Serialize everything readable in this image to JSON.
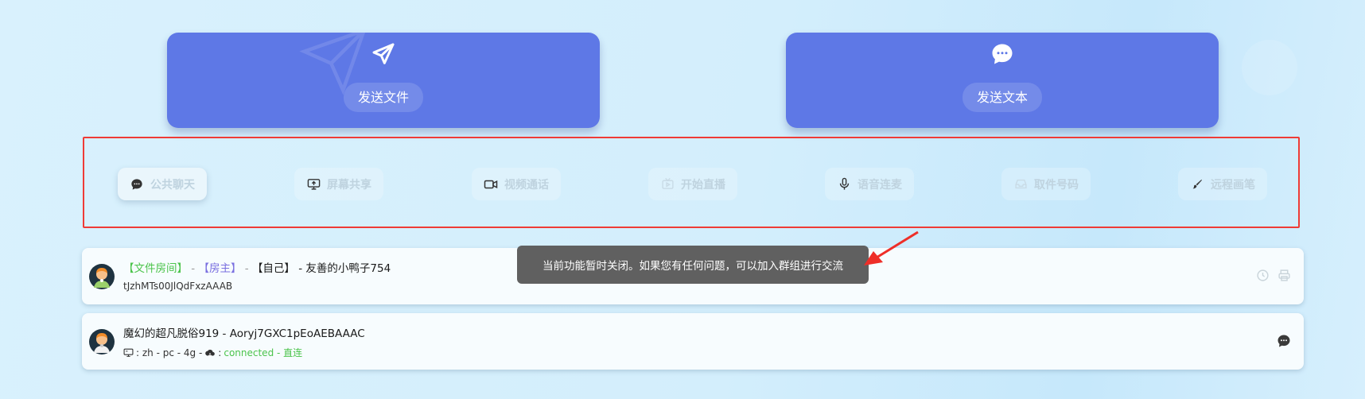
{
  "send_cards": {
    "file": {
      "label": "发送文件",
      "icon": "paper-plane-icon"
    },
    "text": {
      "label": "发送文本",
      "icon": "chat-bubble-icon"
    }
  },
  "functions": [
    {
      "label": "公共聊天",
      "icon": "chat-bubble-icon",
      "active": true
    },
    {
      "label": "屏幕共享",
      "icon": "screen-share-icon",
      "active": false
    },
    {
      "label": "视频通话",
      "icon": "video-camera-icon",
      "active": false
    },
    {
      "label": "开始直播",
      "icon": "live-tv-icon",
      "active": false
    },
    {
      "label": "语音连麦",
      "icon": "microphone-icon",
      "active": false
    },
    {
      "label": "取件号码",
      "icon": "inbox-icon",
      "active": false
    },
    {
      "label": "远程画笔",
      "icon": "brush-icon",
      "active": false
    }
  ],
  "rooms": {
    "self": {
      "tag_room": "【文件房间】",
      "sep1": " - ",
      "tag_owner": "【房主】",
      "sep2": " - ",
      "tag_self": "【自己】",
      "name": " - 友善的小鸭子754",
      "id": "tJzhMTs00JlQdFxzAAAB",
      "icons": [
        "clock-icon",
        "printer-icon"
      ]
    },
    "peer": {
      "name": "魔幻的超凡脱俗919 - Aoryj7GXC1pEoAEBAAAC",
      "device_info": ": zh - pc - 4g - ",
      "status_prefix": ": ",
      "status": "connected - 直连",
      "icons": [
        "chat-bubble-icon"
      ]
    }
  },
  "toast": {
    "message": "当前功能暂时关闭。如果您有任何问题，可以加入群组进行交流"
  },
  "colors": {
    "card_bg": "#5e78e6",
    "highlight_border": "#ef3b36",
    "status_green": "#4cc44c",
    "owner_purple": "#7a6fe0",
    "toast_bg": "#606060"
  }
}
